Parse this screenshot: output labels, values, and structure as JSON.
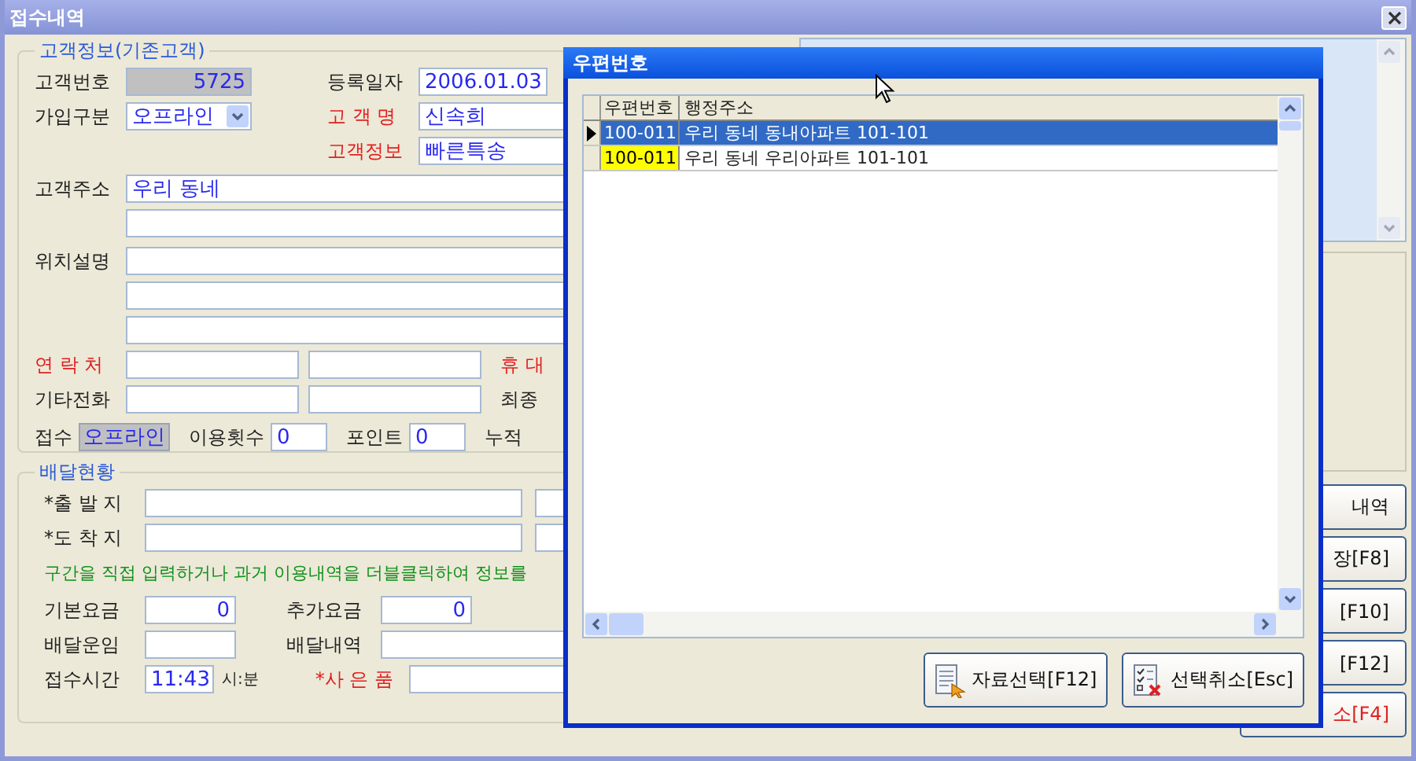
{
  "window": {
    "title": "접수내역"
  },
  "customer": {
    "title": "고객정보(기존고객)",
    "customer_no": {
      "label": "고객번호",
      "value": "5725",
      "required": false
    },
    "reg_date": {
      "label": "등록일자",
      "value": "2006.01.03",
      "required": false
    },
    "join_type": {
      "label": "가입구분",
      "value": "오프라인",
      "required": false
    },
    "name": {
      "label": "고 객 명",
      "value": "신속희",
      "required": true
    },
    "info": {
      "label": "고객정보",
      "value": "빠른특송",
      "required": true
    },
    "address": {
      "label": "고객주소",
      "value": "우리 동네",
      "required": false
    },
    "location": {
      "label": "위치설명",
      "required": false
    },
    "contact": {
      "label": "연 락 처",
      "required": true
    },
    "mobile": {
      "label": "휴 대",
      "required": true
    },
    "other_phone": {
      "label": "기타전화",
      "required": false
    },
    "last": {
      "label": "최종",
      "required": false
    },
    "receipt": {
      "label": "접수",
      "value": "오프라인",
      "required": false
    },
    "use_count": {
      "label": "이용횟수",
      "value": "0",
      "required": false
    },
    "points": {
      "label": "포인트",
      "value": "0",
      "required": false
    },
    "total": {
      "label": "누적",
      "required": false
    }
  },
  "delivery": {
    "title": "배달현황",
    "origin": {
      "label": "*출 발 지",
      "required": false
    },
    "destination": {
      "label": "*도 착 지",
      "required": false
    },
    "hint": "구간을 직접 입력하거나 과거 이용내역을 더블클릭하여 정보를",
    "base_fee": {
      "label": "기본요금",
      "value": "0",
      "required": false
    },
    "extra_fee": {
      "label": "추가요금",
      "value": "0",
      "required": false
    },
    "fare": {
      "label": "배달운임",
      "required": false
    },
    "detail": {
      "label": "배달내역",
      "required": false
    },
    "time": {
      "label": "접수시간",
      "value": "11:43",
      "unit": "시:분",
      "required": false
    },
    "gift": {
      "label": "*사 은 품",
      "required": true
    }
  },
  "side_buttons": [
    {
      "label": "내역",
      "danger": false
    },
    {
      "label": "장[F8]",
      "danger": false
    },
    {
      "label": "[F10]",
      "danger": false
    },
    {
      "label": "[F12]",
      "danger": false
    },
    {
      "label": "소[F4]",
      "danger": true
    }
  ],
  "dialog": {
    "title": "우편번호",
    "columns": [
      "우편번호",
      "행정주소"
    ],
    "rows": [
      {
        "code": "100-011",
        "address": "우리 동네 동내아파트 101-101",
        "selected": true,
        "highlight": false
      },
      {
        "code": "100-011",
        "address": "우리 동네 우리아파트 101-101",
        "selected": false,
        "highlight": true
      }
    ],
    "buttons": [
      {
        "label": "자료선택[F12]",
        "kind": "select"
      },
      {
        "label": "선택취소[Esc]",
        "kind": "cancel"
      }
    ]
  }
}
